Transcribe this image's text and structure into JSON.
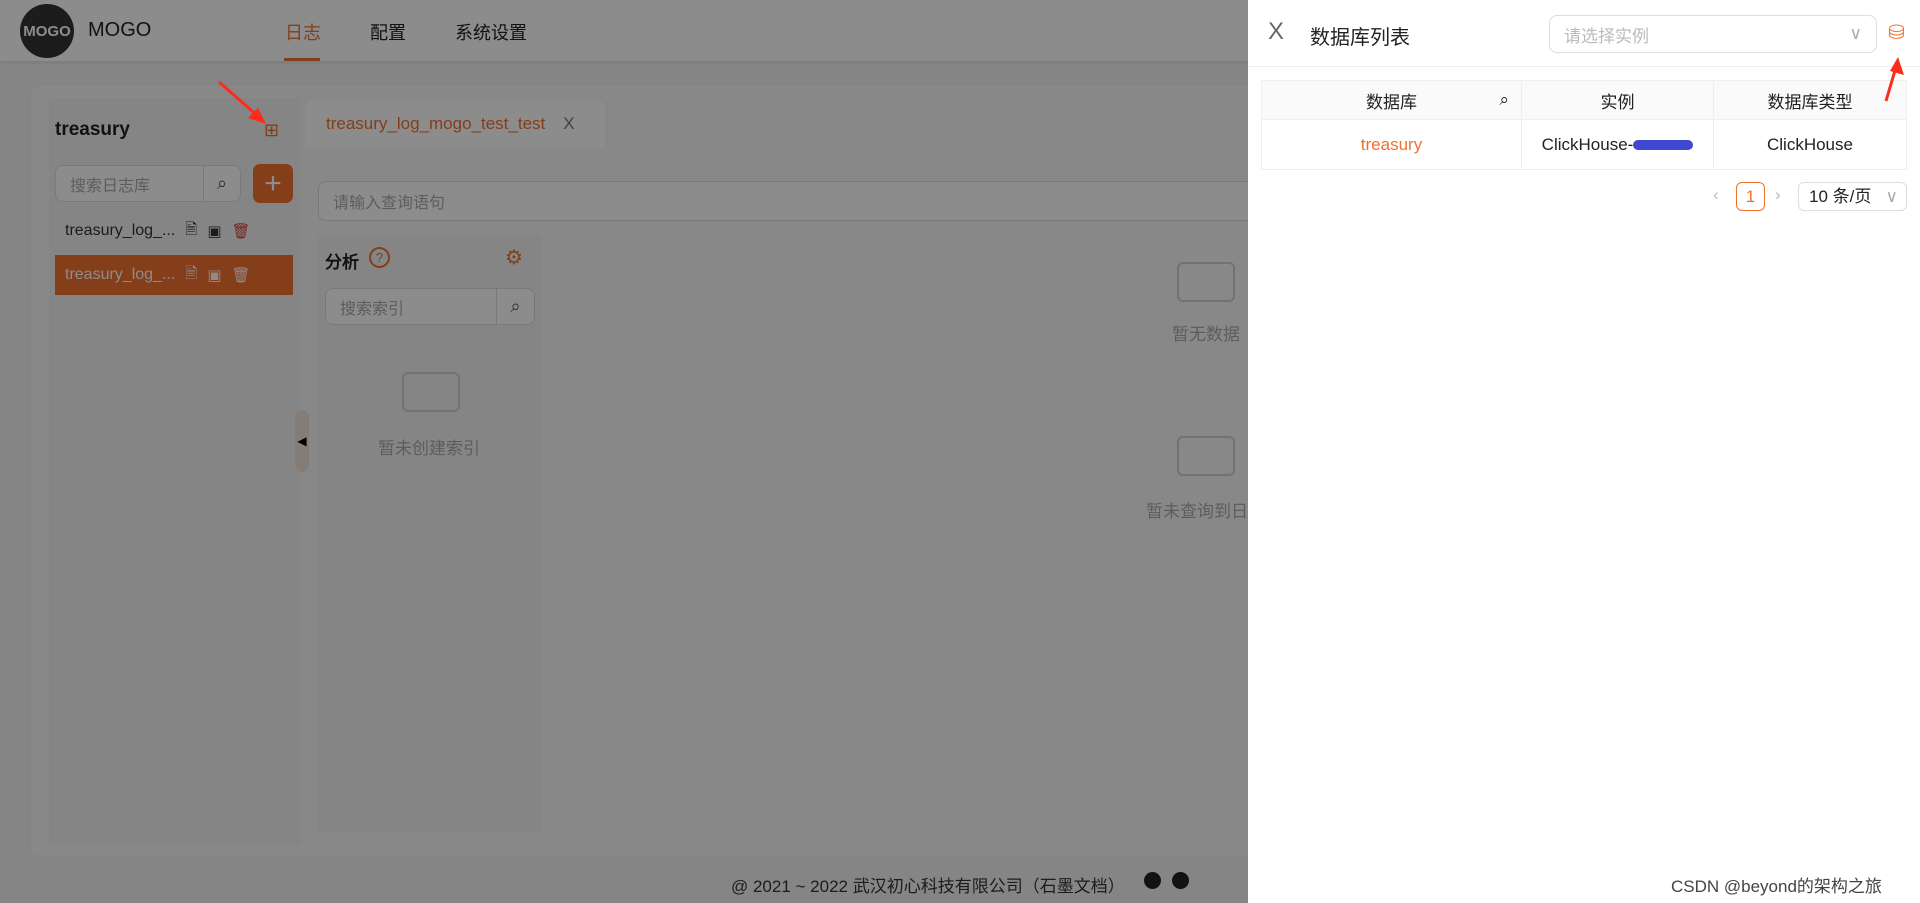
{
  "header": {
    "logo": "MOGO",
    "brand": "MOGO",
    "nav": [
      {
        "label": "日志",
        "active": true
      },
      {
        "label": "配置"
      },
      {
        "label": "系统设置"
      }
    ]
  },
  "sidebar": {
    "title": "treasury",
    "search_placeholder": "搜索日志库",
    "add_label": "+",
    "items": [
      {
        "label": "treasury_log_..."
      },
      {
        "label": "treasury_log_...",
        "active": true
      }
    ]
  },
  "tab": {
    "label": "treasury_log_mogo_test_test",
    "close": "X"
  },
  "query": {
    "placeholder": "请输入查询语句"
  },
  "analysis": {
    "title": "分析",
    "help": "?",
    "search_placeholder": "搜索索引",
    "empty": "暂未创建索引"
  },
  "main": {
    "empty_data": "暂无数据",
    "empty_logs": "暂未查询到日志"
  },
  "footer": {
    "text": "@ 2021 ~ 2022 武汉初心科技有限公司（石墨文档）"
  },
  "drawer": {
    "close": "X",
    "title": "数据库列表",
    "select_placeholder": "请选择实例",
    "columns": [
      "数据库",
      "实例",
      "数据库类型"
    ],
    "rows": [
      {
        "database": "treasury",
        "instance": "ClickHouse-",
        "type": "ClickHouse"
      }
    ],
    "pagination": {
      "current": "1",
      "page_size": "10 条/页"
    }
  },
  "watermark": "CSDN @beyond的架构之旅",
  "colors": {
    "accent": "#f0712f",
    "annotation_arrow": "#ff2a1a"
  }
}
